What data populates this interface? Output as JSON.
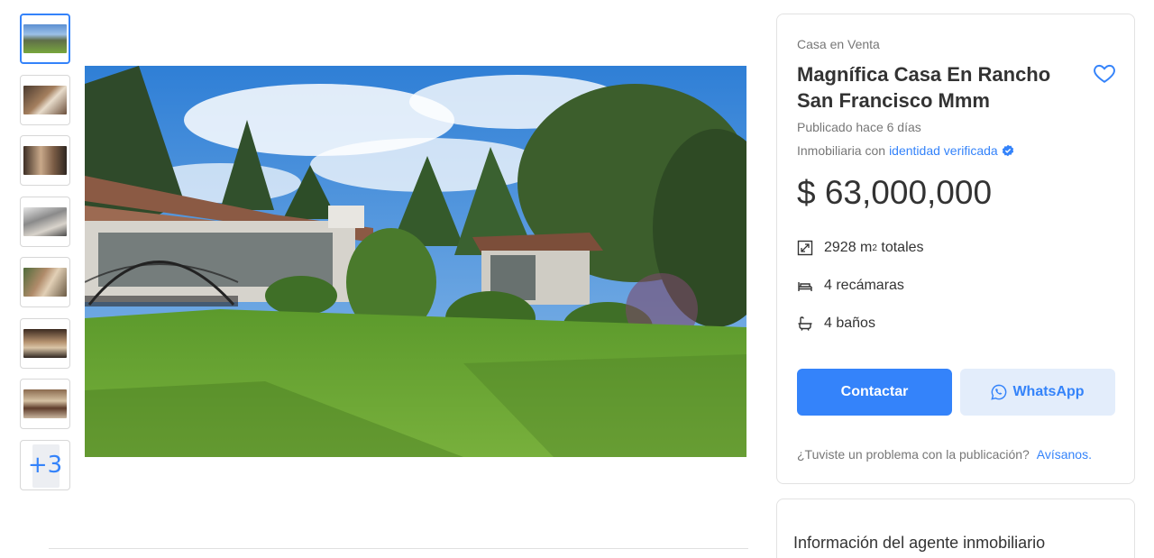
{
  "gallery": {
    "more_label": "+3",
    "thumbnails": [
      "thumb-1",
      "thumb-2",
      "thumb-3",
      "thumb-4",
      "thumb-5",
      "thumb-6",
      "thumb-7"
    ],
    "main_image_alt": "house-with-garden"
  },
  "listing": {
    "category": "Casa en Venta",
    "title": "Magnífica Casa En Rancho San Francisco Mmm",
    "published": "Publicado hace 6 días",
    "agency_prefix": "Inmobiliaria con",
    "agency_link": "identidad verificada",
    "price": "$ 63,000,000",
    "features": {
      "area_value": "2928 m",
      "area_sup": "2",
      "area_suffix": " totales",
      "bedrooms": "4 recámaras",
      "bathrooms": "4 baños"
    },
    "contact_label": "Contactar",
    "whatsapp_label": "WhatsApp",
    "problem_text": "¿Tuviste un problema con la publicación?",
    "problem_link": "Avísanos."
  },
  "agent": {
    "title": "Información del agente inmobiliario"
  },
  "colors": {
    "accent": "#3483fa",
    "whatsapp_bg": "#e3edfb",
    "text_muted": "#777777"
  },
  "icons": [
    "heart-icon",
    "verified-badge-icon",
    "area-icon",
    "bed-icon",
    "bath-icon",
    "whatsapp-icon"
  ]
}
